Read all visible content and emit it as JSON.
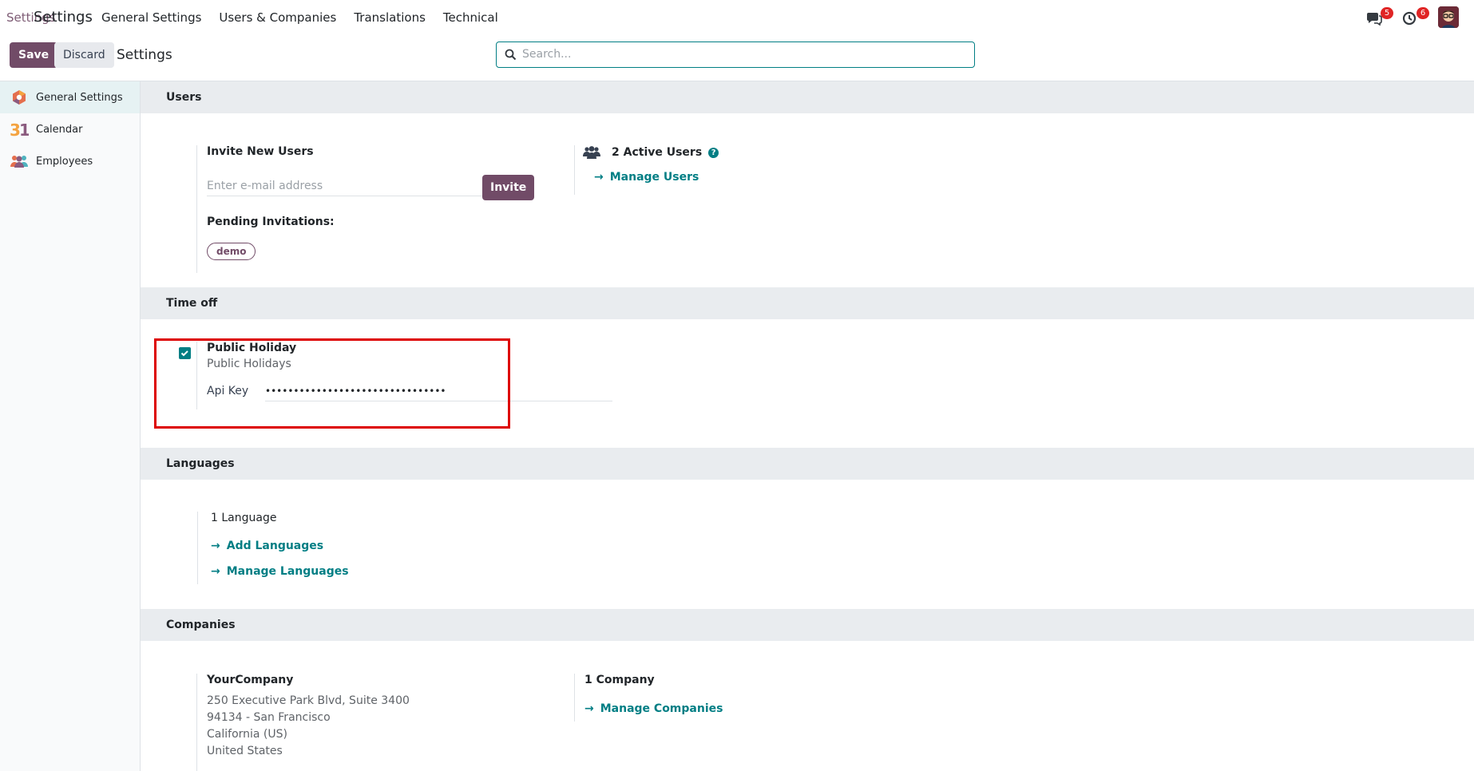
{
  "navbar": {
    "app_name": "Settings",
    "app_name_ghost": "Settings",
    "menu": [
      "General Settings",
      "Users & Companies",
      "Translations",
      "Technical"
    ],
    "messages_count": "5",
    "activities_count": "6"
  },
  "control_panel": {
    "save_label": "Save",
    "discard_label": "Discard",
    "title": "Settings",
    "search_placeholder": "Search..."
  },
  "sidebar": {
    "items": [
      {
        "label": "General Settings",
        "icon": "settings-app-icon",
        "active": true
      },
      {
        "label": "Calendar",
        "icon": "calendar-app-icon",
        "active": false
      },
      {
        "label": "Employees",
        "icon": "employees-app-icon",
        "active": false
      }
    ]
  },
  "users": {
    "header": "Users",
    "invite_title": "Invite New Users",
    "email_placeholder": "Enter e-mail address",
    "invite_label": "Invite",
    "pending_title": "Pending Invitations:",
    "pending": [
      "demo"
    ],
    "active_users": "2 Active Users",
    "manage_users": "Manage Users"
  },
  "time_off": {
    "header": "Time off",
    "setting_title": "Public Holiday",
    "setting_desc": "Public Holidays",
    "checked": true,
    "api_key_label": "Api Key",
    "api_key_value": "••••••••••••••••••••••••••••••••"
  },
  "languages": {
    "header": "Languages",
    "count": "1 Language",
    "add": "Add Languages",
    "manage": "Manage Languages"
  },
  "companies": {
    "header": "Companies",
    "company_name": "YourCompany",
    "address": [
      "250 Executive Park Blvd, Suite 3400",
      "94134 - San Francisco",
      "California (US)",
      "United States"
    ],
    "count": "1 Company",
    "manage": "Manage Companies"
  },
  "colors": {
    "primary": "#714b67",
    "link": "#017e84",
    "highlight": "#dd0000"
  }
}
